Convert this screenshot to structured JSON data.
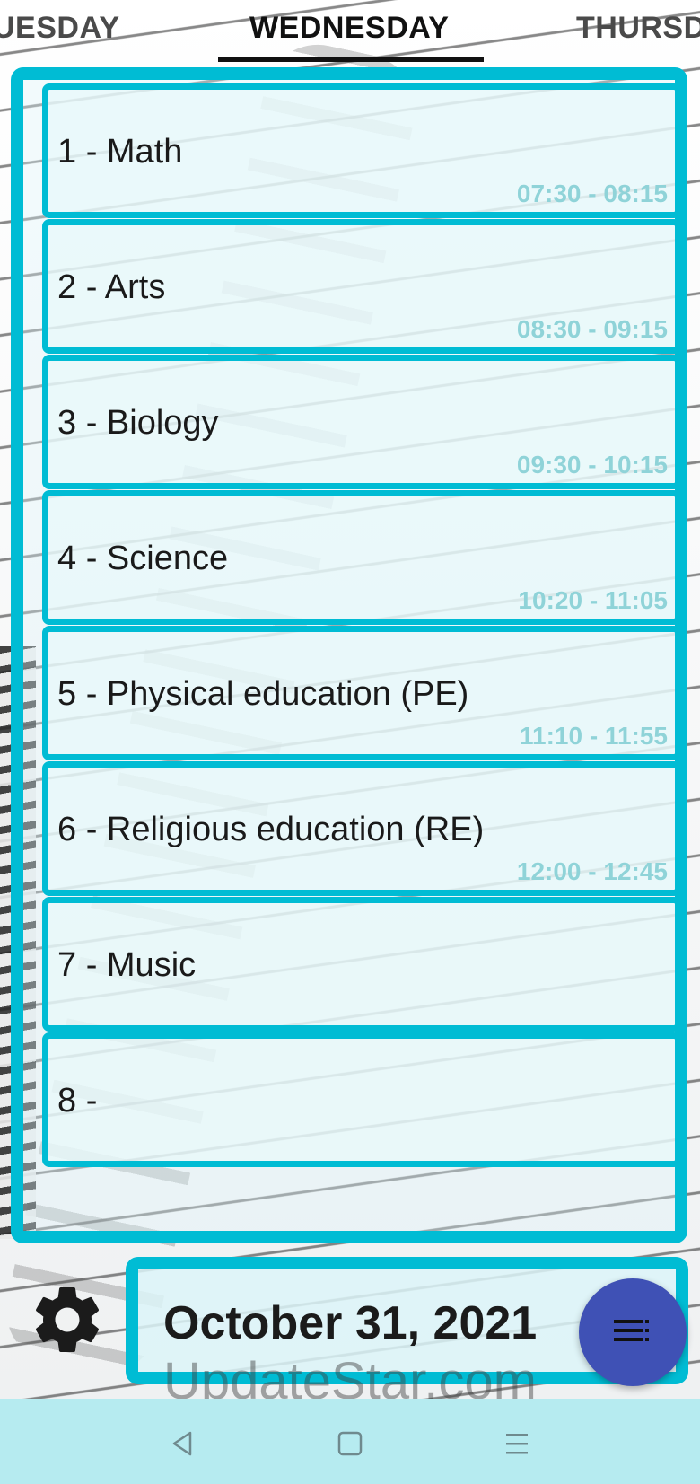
{
  "tabs": {
    "prev": "UESDAY",
    "current": "WEDNESDAY",
    "next": "THURSD"
  },
  "schedule": [
    {
      "title": "1 - Math",
      "time": "07:30 - 08:15"
    },
    {
      "title": "2 - Arts",
      "time": "08:30 - 09:15"
    },
    {
      "title": "3 - Biology",
      "time": "09:30 - 10:15"
    },
    {
      "title": "4 - Science",
      "time": "10:20 - 11:05"
    },
    {
      "title": "5 - Physical education (PE)",
      "time": "11:10 - 11:55"
    },
    {
      "title": "6 - Religious education (RE)",
      "time": "12:00 - 12:45"
    },
    {
      "title": "7 - Music",
      "time": ""
    },
    {
      "title": "8 -",
      "time": ""
    }
  ],
  "date": "October 31, 2021",
  "watermark": "UpdateStar.com",
  "icons": {
    "settings": "gear-icon",
    "fab": "sort-list-icon",
    "nav_back": "back-triangle-icon",
    "nav_home": "home-square-icon",
    "nav_menu": "menu-lines-icon"
  },
  "colors": {
    "accent": "#00bcd4",
    "fab": "#3f51b5",
    "time_text": "#8fd3d8",
    "navbar": "#b6ebf0"
  }
}
